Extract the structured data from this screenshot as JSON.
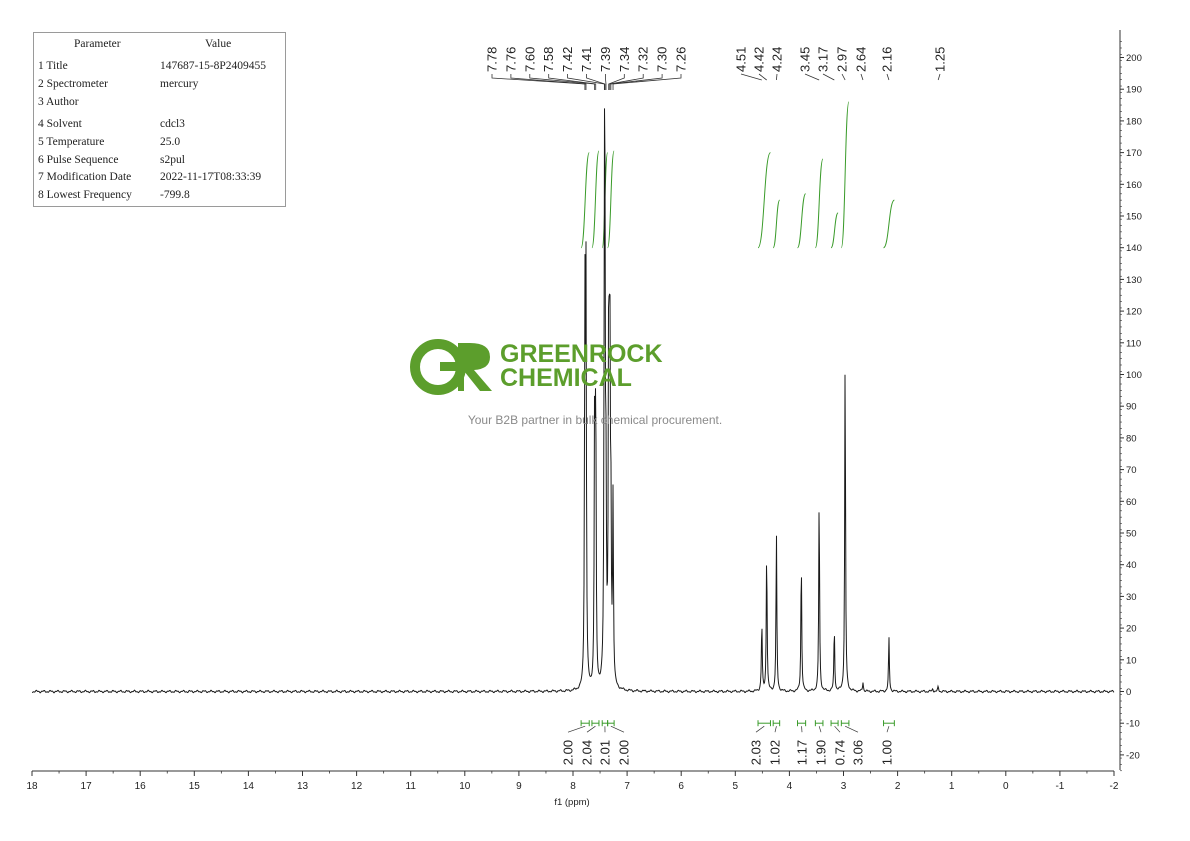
{
  "colors": {
    "spectrum": "#1a1a1a",
    "integral": "#3a9b2a",
    "axis": "#333333",
    "brand": "#5c9e2c"
  },
  "parameters": {
    "header": {
      "name": "Parameter",
      "value": "Value"
    },
    "rows": [
      {
        "name": "1 Title",
        "value": "147687-15-8P2409455"
      },
      {
        "name": "2 Spectrometer",
        "value": "mercury"
      },
      {
        "name": "3 Author",
        "value": ""
      },
      {
        "name": "4 Solvent",
        "value": "cdcl3"
      },
      {
        "name": "5 Temperature",
        "value": "25.0"
      },
      {
        "name": "6 Pulse Sequence",
        "value": "s2pul"
      },
      {
        "name": "7 Modification Date",
        "value": "2022-11-17T08:33:39"
      },
      {
        "name": "8 Lowest Frequency",
        "value": "-799.8"
      }
    ]
  },
  "watermark": {
    "logo_letters": "GR",
    "brand_line1": "GREENROCK",
    "brand_line2": "CHEMICAL",
    "tagline": "Your B2B partner in bulk chemical procurement."
  },
  "chart_data": {
    "type": "line",
    "title": "",
    "xlabel": "f1 (ppm)",
    "ylabel": "",
    "xlim": [
      18,
      -2
    ],
    "ylim": [
      -25,
      205
    ],
    "x_ticks": [
      18,
      17,
      16,
      15,
      14,
      13,
      12,
      11,
      10,
      9,
      8,
      7,
      6,
      5,
      4,
      3,
      2,
      1,
      0,
      -1,
      -2
    ],
    "y_ticks": [
      200,
      190,
      180,
      170,
      160,
      150,
      140,
      130,
      120,
      110,
      100,
      90,
      80,
      70,
      60,
      50,
      40,
      30,
      20,
      10,
      0,
      -10,
      -20
    ],
    "peaks": [
      {
        "ppm": 7.78,
        "height": 118
      },
      {
        "ppm": 7.76,
        "height": 122
      },
      {
        "ppm": 7.6,
        "height": 86
      },
      {
        "ppm": 7.58,
        "height": 88
      },
      {
        "ppm": 7.42,
        "height": 118
      },
      {
        "ppm": 7.41,
        "height": 112
      },
      {
        "ppm": 7.39,
        "height": 52
      },
      {
        "ppm": 7.34,
        "height": 116
      },
      {
        "ppm": 7.32,
        "height": 112
      },
      {
        "ppm": 7.3,
        "height": 50
      },
      {
        "ppm": 7.26,
        "height": 58
      },
      {
        "ppm": 4.51,
        "height": 22
      },
      {
        "ppm": 4.42,
        "height": 45
      },
      {
        "ppm": 4.24,
        "height": 50
      },
      {
        "ppm": 3.78,
        "height": 42
      },
      {
        "ppm": 3.45,
        "height": 62
      },
      {
        "ppm": 3.17,
        "height": 20
      },
      {
        "ppm": 2.97,
        "height": 106
      },
      {
        "ppm": 2.64,
        "height": 3
      },
      {
        "ppm": 2.16,
        "height": 17
      },
      {
        "ppm": 1.35,
        "height": 1
      },
      {
        "ppm": 1.25,
        "height": 1.5
      }
    ],
    "peak_labels": [
      "7.78",
      "7.76",
      "7.60",
      "7.58",
      "7.42",
      "7.41",
      "7.39",
      "7.34",
      "7.32",
      "7.30",
      "7.26",
      "4.51",
      "4.42",
      "4.24",
      "3.45",
      "3.17",
      "2.97",
      "2.64",
      "2.16",
      "1.25"
    ],
    "integrals": [
      {
        "from": 7.85,
        "to": 7.7,
        "value": "2.00"
      },
      {
        "from": 7.65,
        "to": 7.52,
        "value": "2.04"
      },
      {
        "from": 7.46,
        "to": 7.36,
        "value": "2.01"
      },
      {
        "from": 7.36,
        "to": 7.24,
        "value": "2.00"
      },
      {
        "from": 4.58,
        "to": 4.35,
        "value": "2.03"
      },
      {
        "from": 4.3,
        "to": 4.18,
        "value": "1.02"
      },
      {
        "from": 3.85,
        "to": 3.7,
        "value": "1.17"
      },
      {
        "from": 3.52,
        "to": 3.38,
        "value": "1.90"
      },
      {
        "from": 3.23,
        "to": 3.1,
        "value": "0.74"
      },
      {
        "from": 3.04,
        "to": 2.9,
        "value": "3.06"
      },
      {
        "from": 2.26,
        "to": 2.06,
        "value": "1.00"
      }
    ],
    "integral_curve_levels": [
      {
        "from": 7.85,
        "to": 7.7,
        "y0": 140,
        "y1": 170
      },
      {
        "from": 7.65,
        "to": 7.52,
        "y0": 140,
        "y1": 170.5
      },
      {
        "from": 7.46,
        "to": 7.36,
        "y0": 140,
        "y1": 170
      },
      {
        "from": 7.36,
        "to": 7.24,
        "y0": 140,
        "y1": 170.5
      },
      {
        "from": 4.58,
        "to": 4.35,
        "y0": 140,
        "y1": 170
      },
      {
        "from": 4.3,
        "to": 4.18,
        "y0": 140,
        "y1": 155
      },
      {
        "from": 3.85,
        "to": 3.7,
        "y0": 140,
        "y1": 157
      },
      {
        "from": 3.52,
        "to": 3.38,
        "y0": 140,
        "y1": 168
      },
      {
        "from": 3.23,
        "to": 3.1,
        "y0": 140,
        "y1": 151
      },
      {
        "from": 3.04,
        "to": 2.9,
        "y0": 140,
        "y1": 186
      },
      {
        "from": 2.26,
        "to": 2.06,
        "y0": 140,
        "y1": 155
      }
    ],
    "grid": false,
    "legend": "none"
  }
}
